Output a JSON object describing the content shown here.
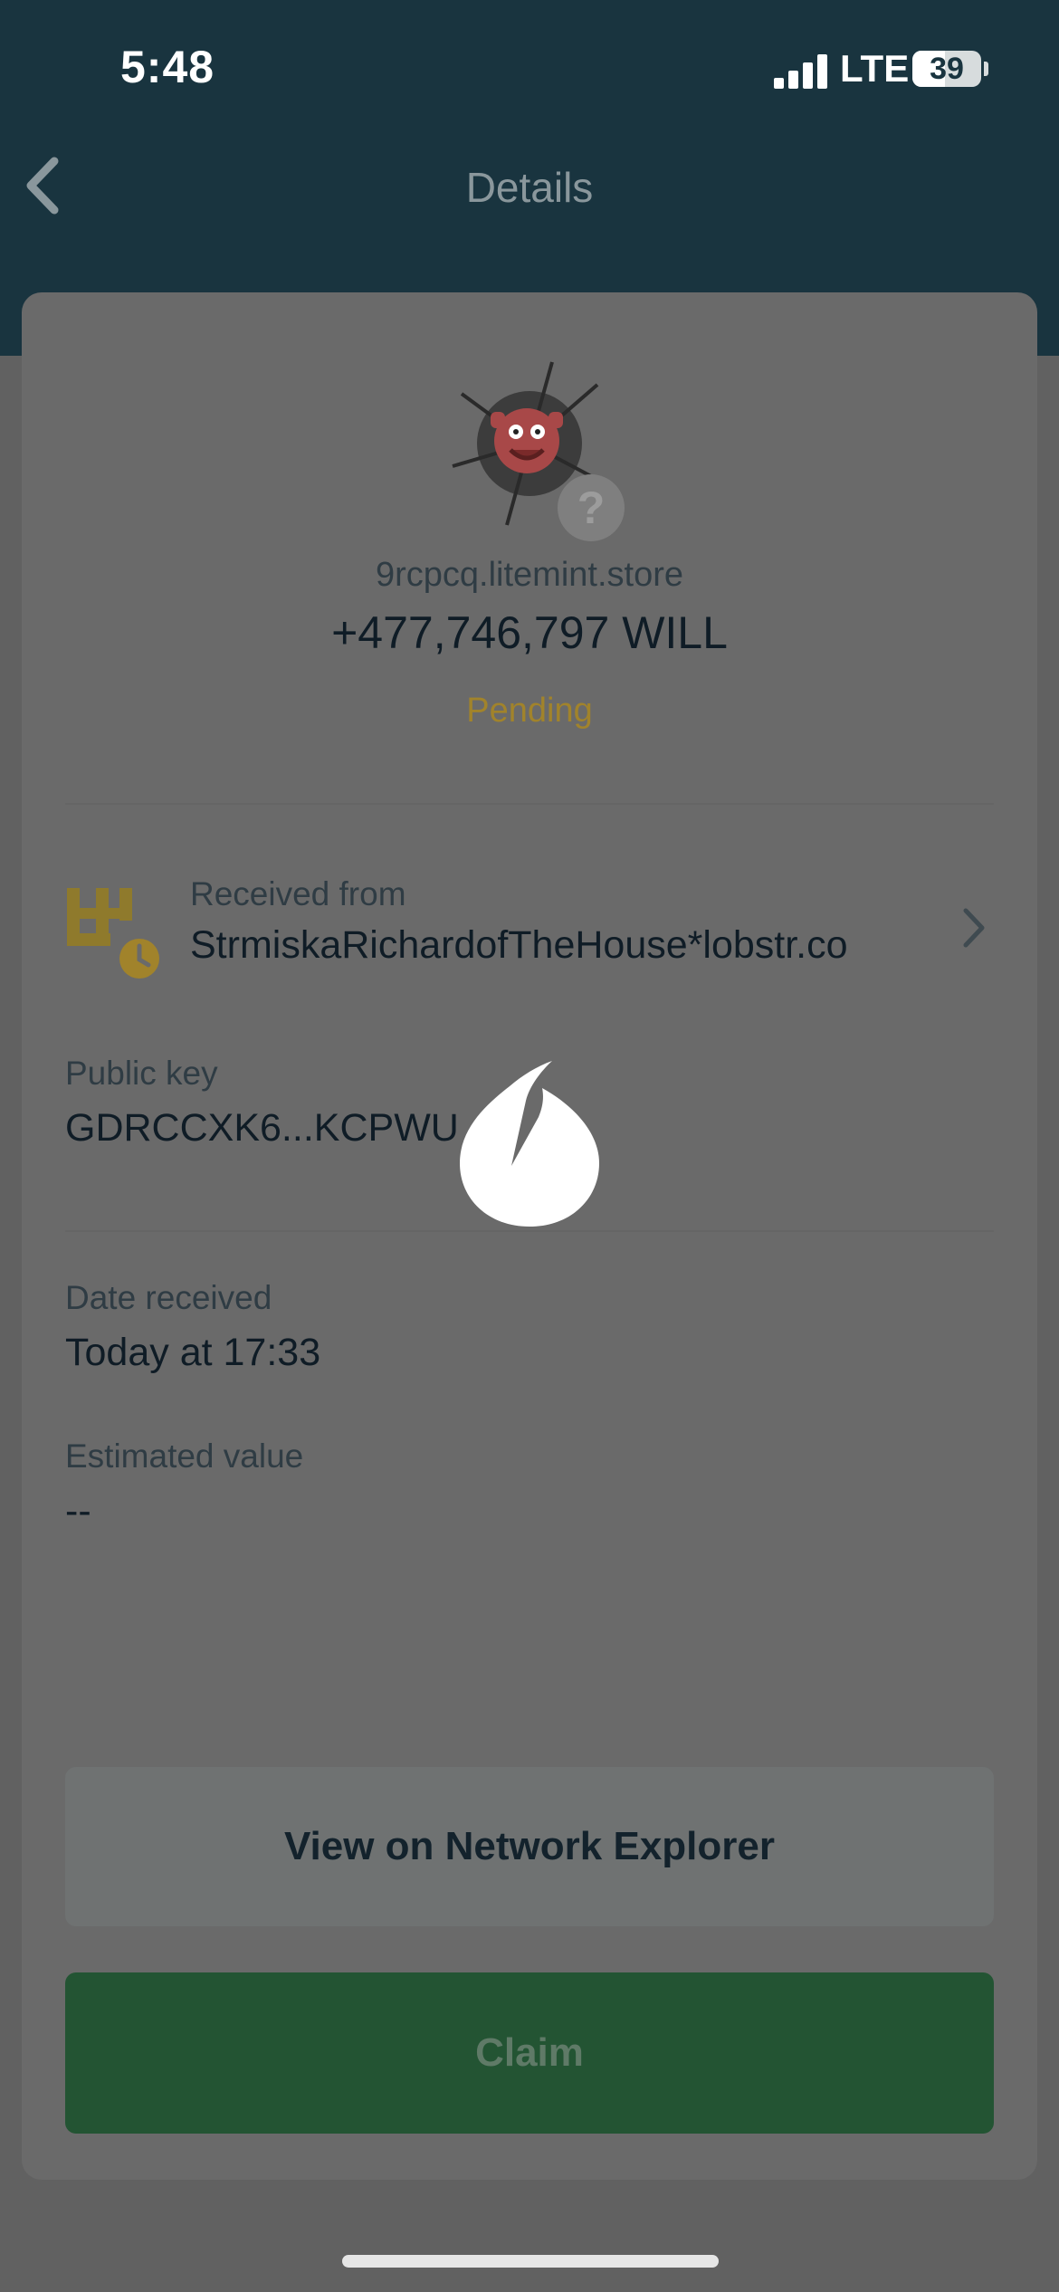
{
  "status_bar": {
    "time": "5:48",
    "network": "LTE",
    "battery": "39"
  },
  "nav": {
    "title": "Details",
    "back_icon": "chevron-left-icon"
  },
  "asset": {
    "avatar_icon": "asset-image",
    "badge_icon": "question-mark-icon",
    "badge_glyph": "?",
    "domain": "9rcpcq.litemint.store",
    "amount": "+477,746,797 WILL",
    "status": "Pending"
  },
  "sender": {
    "icon": "account-pending-icon",
    "label": "Received from",
    "value": "StrmiskaRichardofTheHouse*lobstr.co",
    "chevron_icon": "chevron-right-icon"
  },
  "public_key": {
    "label": "Public key",
    "value": "GDRCCXK6...KCPWU   Y"
  },
  "date": {
    "label": "Date received",
    "value": "Today at 17:33"
  },
  "estimated_value": {
    "label": "Estimated value",
    "value": "--"
  },
  "buttons": {
    "explorer_label": "View on Network Explorer",
    "claim_label": "Claim"
  },
  "loading_icon": "loading-spinner-icon",
  "colors": {
    "header": "#19343f",
    "pending": "#a1832b",
    "claim": "#235433"
  }
}
